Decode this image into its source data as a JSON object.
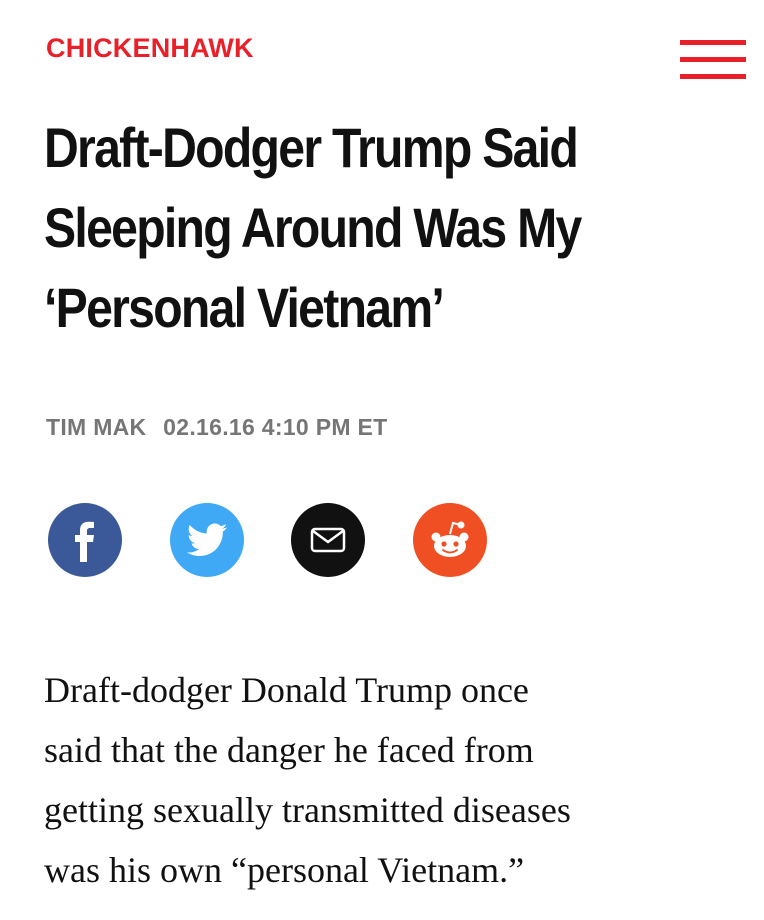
{
  "header": {
    "kicker": "CHICKENHAWK",
    "menu_icon": "hamburger-menu-icon",
    "accent_color": "#e8202a"
  },
  "article": {
    "headline_lines": [
      "Draft-Dodger Trump Said",
      "Sleeping Around Was My",
      "‘Personal Vietnam’"
    ],
    "author": "TIM MAK",
    "date": "02.16.16 4:10 PM ET",
    "body_lines": [
      "Draft-dodger Donald Trump once",
      "said that the danger he faced from",
      "getting sexually transmitted diseases",
      "was his own “personal Vietnam.”"
    ]
  },
  "share": [
    {
      "icon": "facebook-icon",
      "color": "#3b5998"
    },
    {
      "icon": "twitter-icon",
      "color": "#3fa9f5"
    },
    {
      "icon": "email-icon",
      "color": "#111111"
    },
    {
      "icon": "reddit-icon",
      "color": "#f04e23"
    }
  ]
}
